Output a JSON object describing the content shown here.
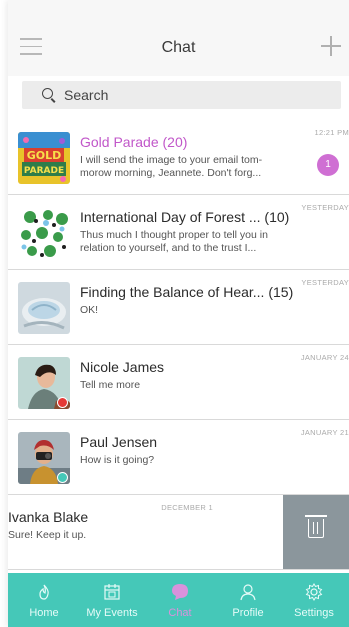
{
  "header": {
    "title": "Chat"
  },
  "search": {
    "placeholder": "Search"
  },
  "chats": [
    {
      "name": "Gold Parade (20)",
      "preview": "I will send the image to your email tom-morow morning, Jeannete. Don't forg...",
      "time": "12:21 PM",
      "unread": "1",
      "highlight": true
    },
    {
      "name": "International Day of Forest ... (10)",
      "preview": "Thus much I thought proper to tell you in relation to yourself, and to the trust I...",
      "time": "YESTERDAY"
    },
    {
      "name": "Finding the Balance of Hear... (15)",
      "preview": "OK!",
      "time": "YESTERDAY"
    },
    {
      "name": "Nicole James",
      "preview": "Tell me more",
      "time": "JANUARY 24",
      "status": "#e53935"
    },
    {
      "name": "Paul Jensen",
      "preview": "How is it going?",
      "time": "JANUARY 21",
      "status": "#45c8b8"
    },
    {
      "name": "Ivanka Blake",
      "preview": "Sure! Keep it up.",
      "time": "DECEMBER 1"
    }
  ],
  "tabs": [
    {
      "label": "Home",
      "icon": "flame-icon"
    },
    {
      "label": "My Events",
      "icon": "calendar-icon"
    },
    {
      "label": "Chat",
      "icon": "chat-icon",
      "active": true
    },
    {
      "label": "Profile",
      "icon": "user-icon"
    },
    {
      "label": "Settings",
      "icon": "gear-icon"
    }
  ],
  "colors": {
    "accent": "#45c8b8",
    "highlight": "#c157c9",
    "badge": "#cf6fd3",
    "delete": "#8b969c"
  }
}
